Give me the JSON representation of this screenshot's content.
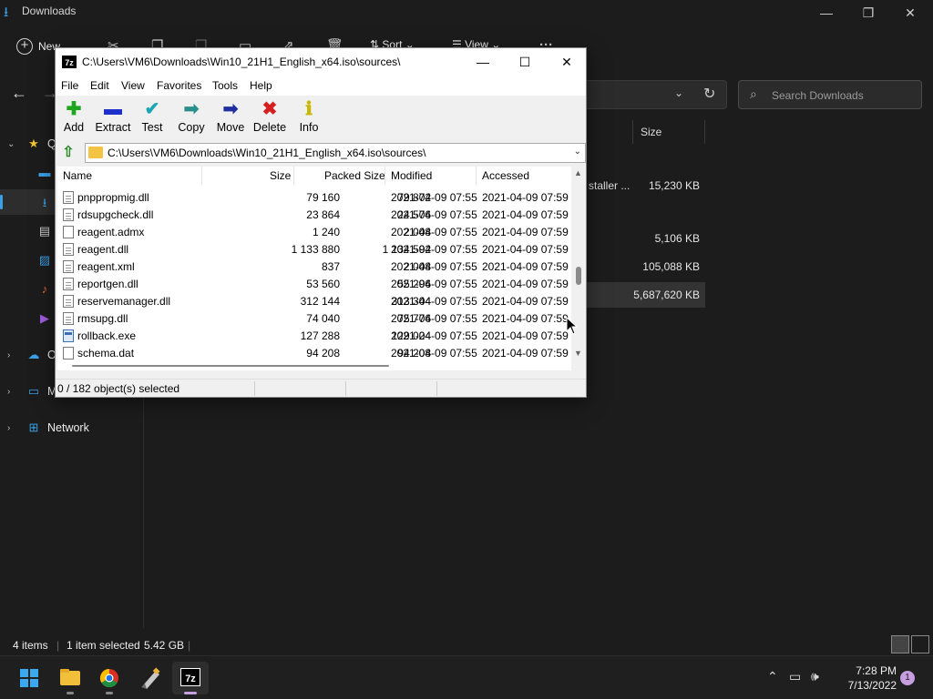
{
  "explorer": {
    "title": "Downloads",
    "new_label": "New",
    "sort_label": "Sort",
    "view_label": "View",
    "search_placeholder": "Search Downloads",
    "size_header": "Size",
    "sidebar": {
      "quick_access": "Q",
      "onedrive": "O",
      "this_pc": "M",
      "network": "Network"
    },
    "rows": [
      {
        "name": "staller ...",
        "size": "15,230 KB"
      },
      {
        "name": "",
        "size": "5,106 KB"
      },
      {
        "name": "",
        "size": "105,088 KB"
      },
      {
        "name": "",
        "size": "5,687,620 KB"
      }
    ],
    "status": {
      "items": "4 items",
      "selected": "1 item selected",
      "selected_size": "5.42 GB"
    }
  },
  "sevenzip": {
    "title": "C:\\Users\\VM6\\Downloads\\Win10_21H1_English_x64.iso\\sources\\",
    "app_icon": "7z",
    "menu": [
      "File",
      "Edit",
      "View",
      "Favorites",
      "Tools",
      "Help"
    ],
    "toolbar": [
      {
        "label": "Add",
        "icon": "plus-icon",
        "color": "#1fa61f"
      },
      {
        "label": "Extract",
        "icon": "minus-icon",
        "color": "#1f2fc9"
      },
      {
        "label": "Test",
        "icon": "check-icon",
        "color": "#1aa7b5"
      },
      {
        "label": "Copy",
        "icon": "arrow-right-icon",
        "color": "#2a8f8a"
      },
      {
        "label": "Move",
        "icon": "arrow-right-icon",
        "color": "#1f2fa0"
      },
      {
        "label": "Delete",
        "icon": "x-icon",
        "color": "#d61f1f"
      },
      {
        "label": "Info",
        "icon": "info-icon",
        "color": "#c8b800"
      }
    ],
    "path": "C:\\Users\\VM6\\Downloads\\Win10_21H1_English_x64.iso\\sources\\",
    "columns": {
      "name": "Name",
      "size": "Size",
      "packed": "Packed Size",
      "modified": "Modified",
      "accessed": "Accessed"
    },
    "files": [
      {
        "name": "pnppropmig.dll",
        "size": "79 160",
        "packed": "79 872",
        "modified": "2021-04-09 07:55",
        "accessed": "2021-04-09 07:59",
        "type": "file"
      },
      {
        "name": "rdsupgcheck.dll",
        "size": "23 864",
        "packed": "24 576",
        "modified": "2021-04-09 07:55",
        "accessed": "2021-04-09 07:59",
        "type": "file"
      },
      {
        "name": "reagent.admx",
        "size": "1 240",
        "packed": "2 048",
        "modified": "2021-04-09 07:55",
        "accessed": "2021-04-09 07:59",
        "type": "blank"
      },
      {
        "name": "reagent.dll",
        "size": "1 133 880",
        "packed": "1 134 592",
        "modified": "2021-04-09 07:55",
        "accessed": "2021-04-09 07:59",
        "type": "file"
      },
      {
        "name": "reagent.xml",
        "size": "837",
        "packed": "2 048",
        "modified": "2021-04-09 07:55",
        "accessed": "2021-04-09 07:59",
        "type": "file"
      },
      {
        "name": "reportgen.dll",
        "size": "53 560",
        "packed": "55 296",
        "modified": "2021-04-09 07:55",
        "accessed": "2021-04-09 07:59",
        "type": "file"
      },
      {
        "name": "reservemanager.dll",
        "size": "312 144",
        "packed": "313 344",
        "modified": "2021-04-09 07:55",
        "accessed": "2021-04-09 07:59",
        "type": "file"
      },
      {
        "name": "rmsupg.dll",
        "size": "74 040",
        "packed": "75 776",
        "modified": "2021-04-09 07:55",
        "accessed": "2021-04-09 07:59",
        "type": "file"
      },
      {
        "name": "rollback.exe",
        "size": "127 288",
        "packed": "129 024",
        "modified": "2021-04-09 07:55",
        "accessed": "2021-04-09 07:59",
        "type": "exe"
      },
      {
        "name": "schema.dat",
        "size": "94 208",
        "packed": "94 208",
        "modified": "2021-04-09 07:55",
        "accessed": "2021-04-09 07:59",
        "type": "blank"
      }
    ],
    "status": "0 / 182 object(s) selected"
  },
  "taskbar": {
    "time": "7:28 PM",
    "date": "7/13/2022",
    "notifications": "1",
    "apps": [
      "start",
      "file-explorer",
      "chrome",
      "paint",
      "7zip"
    ]
  }
}
